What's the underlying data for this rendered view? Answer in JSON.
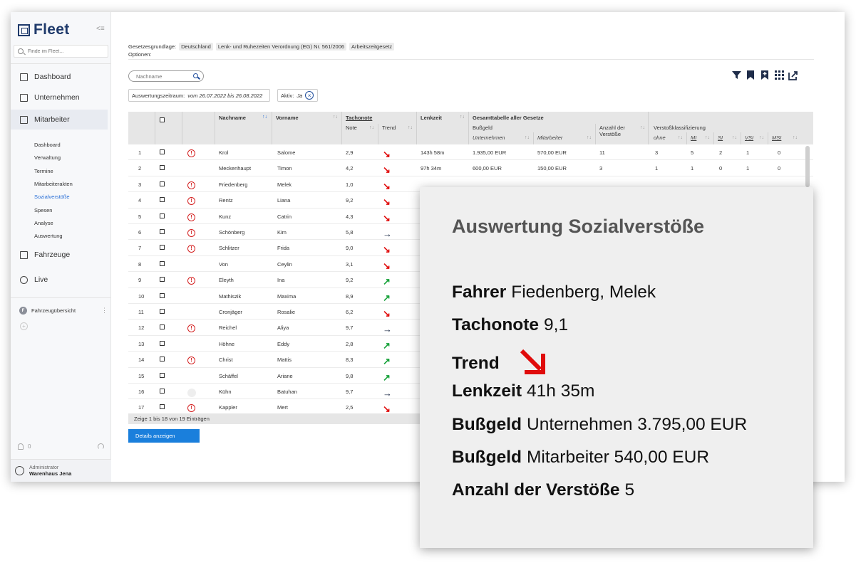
{
  "app": {
    "name": "Fleet"
  },
  "sidebar": {
    "search_placeholder": "Finde im Fleet...",
    "nav": [
      {
        "label": "Dashboard",
        "icon": "dashboard-icon"
      },
      {
        "label": "Unternehmen",
        "icon": "building-icon"
      },
      {
        "label": "Mitarbeiter",
        "icon": "id-card-icon"
      },
      {
        "label": "Fahrzeuge",
        "icon": "truck-icon"
      },
      {
        "label": "Live",
        "icon": "live-icon"
      }
    ],
    "subnav": [
      "Dashboard",
      "Verwaltung",
      "Termine",
      "Mitarbeiterakten",
      "Sozialverstöße",
      "Spesen",
      "Analyse",
      "Auswertung"
    ],
    "active_subnav": "Sozialverstöße",
    "fahrzeug_badge": "F",
    "fahrzeug_label": "Fahrzeugübersicht",
    "notifications": "0",
    "user_role": "Administrator",
    "user_name": "Warenhaus Jena"
  },
  "main": {
    "legal_label": "Gesetzesgrundlage:",
    "legal_tags": [
      "Deutschland",
      "Lenk- und Ruhezeiten Verordnung (EG) Nr. 561/2006",
      "Arbeitszeitgesetz"
    ],
    "options_label": "Optionen:",
    "name_search_placeholder": "Nachname",
    "period_label": "Auswertungszeitraum:",
    "period_value": "vom 26.07.2022 bis 26.08.2022",
    "active_label": "Aktiv:",
    "active_value": "Ja",
    "toolbar_icons": [
      "filter-icon",
      "bookmark-icon",
      "bookmark-add-icon",
      "columns-icon",
      "export-icon"
    ]
  },
  "table": {
    "headers": {
      "nachname": "Nachname",
      "vorname": "Vorname",
      "tachonote": "Tachonote",
      "note": "Note",
      "trend": "Trend",
      "lenkzeit": "Lenkzeit",
      "gesamt": "Gesamttabelle aller Gesetze",
      "bussgeld": "Bußgeld",
      "unternehmen": "Unternehmen",
      "mitarbeiter": "Mitarbeiter",
      "anzahl_1": "Anzahl der",
      "anzahl_2": "Verstöße",
      "klass": "Verstoßklassifizierung",
      "ohne": "ohne",
      "mi": "MI",
      "si": "SI",
      "vsi": "VSI",
      "msi": "MSI"
    },
    "rows": [
      {
        "n": "1",
        "warn": true,
        "last": "Krol",
        "first": "Salome",
        "note": "2,9",
        "trend": "down",
        "lenk": "143h 58m",
        "unt": "1.935,00 EUR",
        "mit": "570,00 EUR",
        "anz": "11",
        "ohne": "3",
        "mi": "5",
        "si": "2",
        "vsi": "1",
        "msi": "0"
      },
      {
        "n": "2",
        "warn": false,
        "last": "Meckenhaupt",
        "first": "Timon",
        "note": "4,2",
        "trend": "down",
        "lenk": "97h 34m",
        "unt": "600,00 EUR",
        "mit": "150,00 EUR",
        "anz": "3",
        "ohne": "1",
        "mi": "1",
        "si": "0",
        "vsi": "1",
        "msi": "0"
      },
      {
        "n": "3",
        "warn": true,
        "last": "Friedenberg",
        "first": "Melek",
        "note": "1,0",
        "trend": "down"
      },
      {
        "n": "4",
        "warn": true,
        "last": "Rentz",
        "first": "Liana",
        "note": "9,2",
        "trend": "down"
      },
      {
        "n": "5",
        "warn": true,
        "last": "Kunz",
        "first": "Catrin",
        "note": "4,3",
        "trend": "down"
      },
      {
        "n": "6",
        "warn": true,
        "last": "Schönberg",
        "first": "Kim",
        "note": "5,8",
        "trend": "flat"
      },
      {
        "n": "7",
        "warn": true,
        "last": "Schlitzer",
        "first": "Frida",
        "note": "9,0",
        "trend": "down"
      },
      {
        "n": "8",
        "warn": false,
        "last": "Von",
        "first": "Ceylin",
        "note": "3,1",
        "trend": "down"
      },
      {
        "n": "9",
        "warn": true,
        "last": "Eleyth",
        "first": "Ina",
        "note": "9,2",
        "trend": "up"
      },
      {
        "n": "10",
        "warn": false,
        "last": "Mathiszik",
        "first": "Maxima",
        "note": "8,9",
        "trend": "up"
      },
      {
        "n": "11",
        "warn": false,
        "last": "Cronjäger",
        "first": "Rosalie",
        "note": "6,2",
        "trend": "down"
      },
      {
        "n": "12",
        "warn": true,
        "last": "Reichel",
        "first": "Aliya",
        "note": "9,7",
        "trend": "flat"
      },
      {
        "n": "13",
        "warn": false,
        "last": "Höhne",
        "first": "Eddy",
        "note": "2,8",
        "trend": "up"
      },
      {
        "n": "14",
        "warn": true,
        "last": "Christ",
        "first": "Mattis",
        "note": "8,3",
        "trend": "up"
      },
      {
        "n": "15",
        "warn": false,
        "last": "Schäffel",
        "first": "Ariane",
        "note": "9,8",
        "trend": "up"
      },
      {
        "n": "16",
        "warn": false,
        "ghost": true,
        "last": "Kühn",
        "first": "Batuhan",
        "note": "9,7",
        "trend": "flat"
      },
      {
        "n": "17",
        "warn": true,
        "last": "Kappler",
        "first": "Mert",
        "note": "2,5",
        "trend": "down"
      }
    ],
    "footer": "Zeige 1 bis 18 von 19 Einträgen",
    "details_button": "Details anzeigen"
  },
  "card": {
    "title": "Auswertung Sozialverstöße",
    "fahrer_label": "Fahrer",
    "fahrer_value": "Fiedenberg, Melek",
    "tacho_label": "Tachonote",
    "tacho_value": "9,1",
    "trend_label": "Trend",
    "trend_value": "down",
    "lenk_label": "Lenkzeit",
    "lenk_value": "41h 35m",
    "bg1_label": "Bußgeld",
    "bg1_value": "Unternehmen 3.795,00 EUR",
    "bg2_label": "Bußgeld",
    "bg2_value": "Mitarbeiter 540,00 EUR",
    "anz_label": "Anzahl der Verstöße",
    "anz_value": "5"
  },
  "colors": {
    "accent": "#1a7fdc",
    "brand": "#1f3a6b",
    "trend_down": "#e00b0b",
    "trend_up": "#17a23a",
    "warn": "#d42020"
  }
}
